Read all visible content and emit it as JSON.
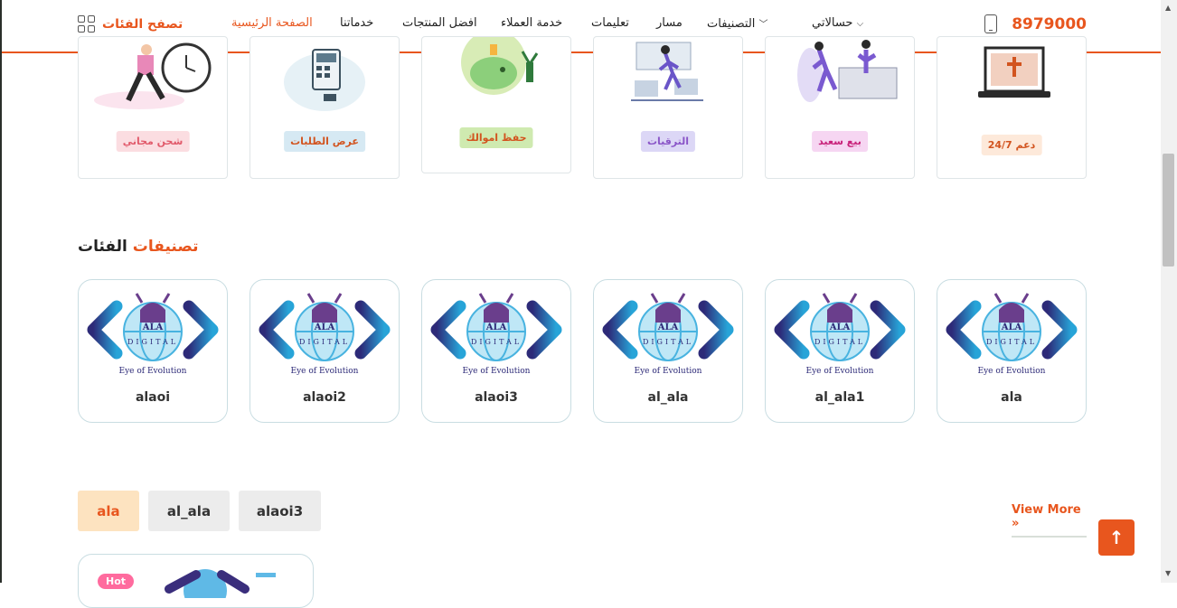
{
  "header": {
    "browse_label": "تصفح الفئات",
    "nav": [
      "الصفحة الرئيسية",
      "خدماتنا",
      "افضل المنتجات",
      "خدمة العملاء",
      "تعليمات",
      "مسار",
      "التصنيفات",
      "حسالاتي"
    ],
    "phone": "8979000",
    "accent_color": "#e8561e"
  },
  "features": [
    {
      "label": "شحن مجاني",
      "color": "#e15a6b",
      "bg": "#fbdde1"
    },
    {
      "label": "عرض الطلبات",
      "color": "#d2541f",
      "bg": "#d6e9f3"
    },
    {
      "label": "حفظ اموالك",
      "color": "#d2541f",
      "bg": "#cfeab0"
    },
    {
      "label": "الترقيات",
      "color": "#8a55c8",
      "bg": "#dcd7f6"
    },
    {
      "label": "بيع سعيد",
      "color": "#c8227a",
      "bg": "#f6d6f2"
    },
    {
      "label": "دعم 24/7",
      "color": "#d2541f",
      "bg": "#fde9da"
    }
  ],
  "section": {
    "title_highlight": "تصنيفات",
    "title_rest": "الفئات"
  },
  "logo_text": {
    "brand": "ALA",
    "word": "DIGITAL",
    "tagline": "Eye of Evolution"
  },
  "categories": [
    "alaoi",
    "alaoi2",
    "alaoi3",
    "al_ala",
    "al_ala1",
    "ala"
  ],
  "tabs": [
    "ala",
    "al_ala",
    "alaoi3"
  ],
  "view_more": "View More »",
  "to_top": "↑",
  "product_badge": "Hot"
}
